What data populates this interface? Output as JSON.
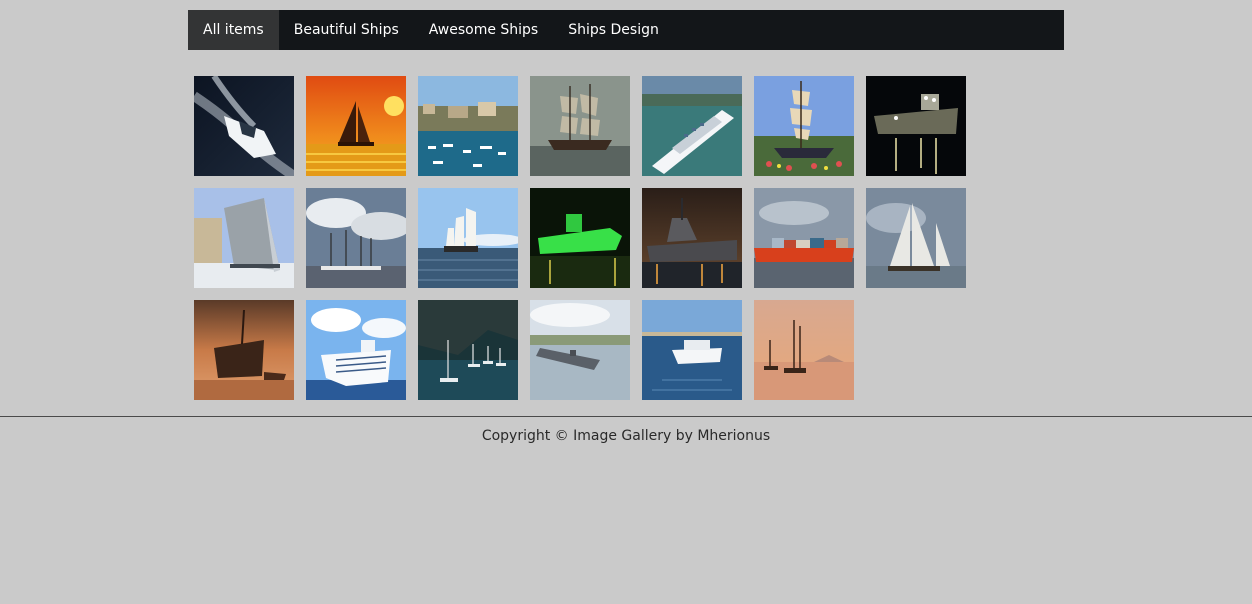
{
  "nav": {
    "items": [
      {
        "label": "All items",
        "active": true
      },
      {
        "label": "Beautiful Ships",
        "active": false
      },
      {
        "label": "Awesome Ships",
        "active": false
      },
      {
        "label": "Ships Design",
        "active": false
      }
    ]
  },
  "gallery": {
    "rows": [
      [
        "speedboat",
        "sailboat-sunset",
        "harbor-marina",
        "tall-ship-mist",
        "cruise-ship-aerial",
        "tall-ship-festival",
        "ship-at-night"
      ],
      [
        "naval-ship-bow",
        "tall-ships-clouds",
        "schooner-sea",
        "green-submarine",
        "battleship-night",
        "container-ship",
        "sailboat-calm"
      ],
      [
        "shipwreck-sunset",
        "cruise-ship-front",
        "sailboats-cove",
        "aircraft-carrier",
        "yacht-blue",
        "sailboats-dusk"
      ]
    ]
  },
  "footer": {
    "copyright": "Copyright © Image Gallery by Mherionus"
  },
  "colors": {
    "page_bg": "#cacaca",
    "nav_bg": "#131619",
    "nav_active_bg": "#333435",
    "nav_text": "#ffffff",
    "footer_text": "#2a2a2a"
  }
}
